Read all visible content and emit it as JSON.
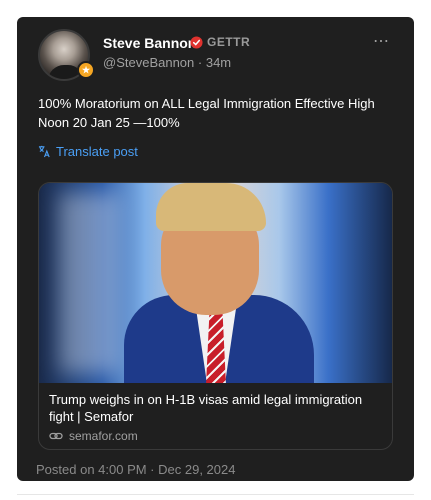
{
  "author": {
    "name": "Steve Bannon",
    "platform": "GETTR",
    "handle": "@SteveBannon",
    "age": "34m",
    "avatar_icon": "user-avatar-icon",
    "verified_icon": "verified-badge-icon",
    "verified_color": "#e0322e",
    "badge_color": "#f5a623"
  },
  "more_icon": "⋯",
  "post": {
    "text": "100% Moratorium on ALL Legal Immigration Effective High Noon 20 Jan 25 —100%",
    "translate_label": "Translate post",
    "translate_color": "#4a9ff5"
  },
  "link_card": {
    "title": "Trump weighs in on H-1B visas amid legal immigration fight | Semafor",
    "domain": "semafor.com",
    "link_icon": "link-icon"
  },
  "timestamp": "Posted on 4:00 PM · Dec 29, 2024"
}
